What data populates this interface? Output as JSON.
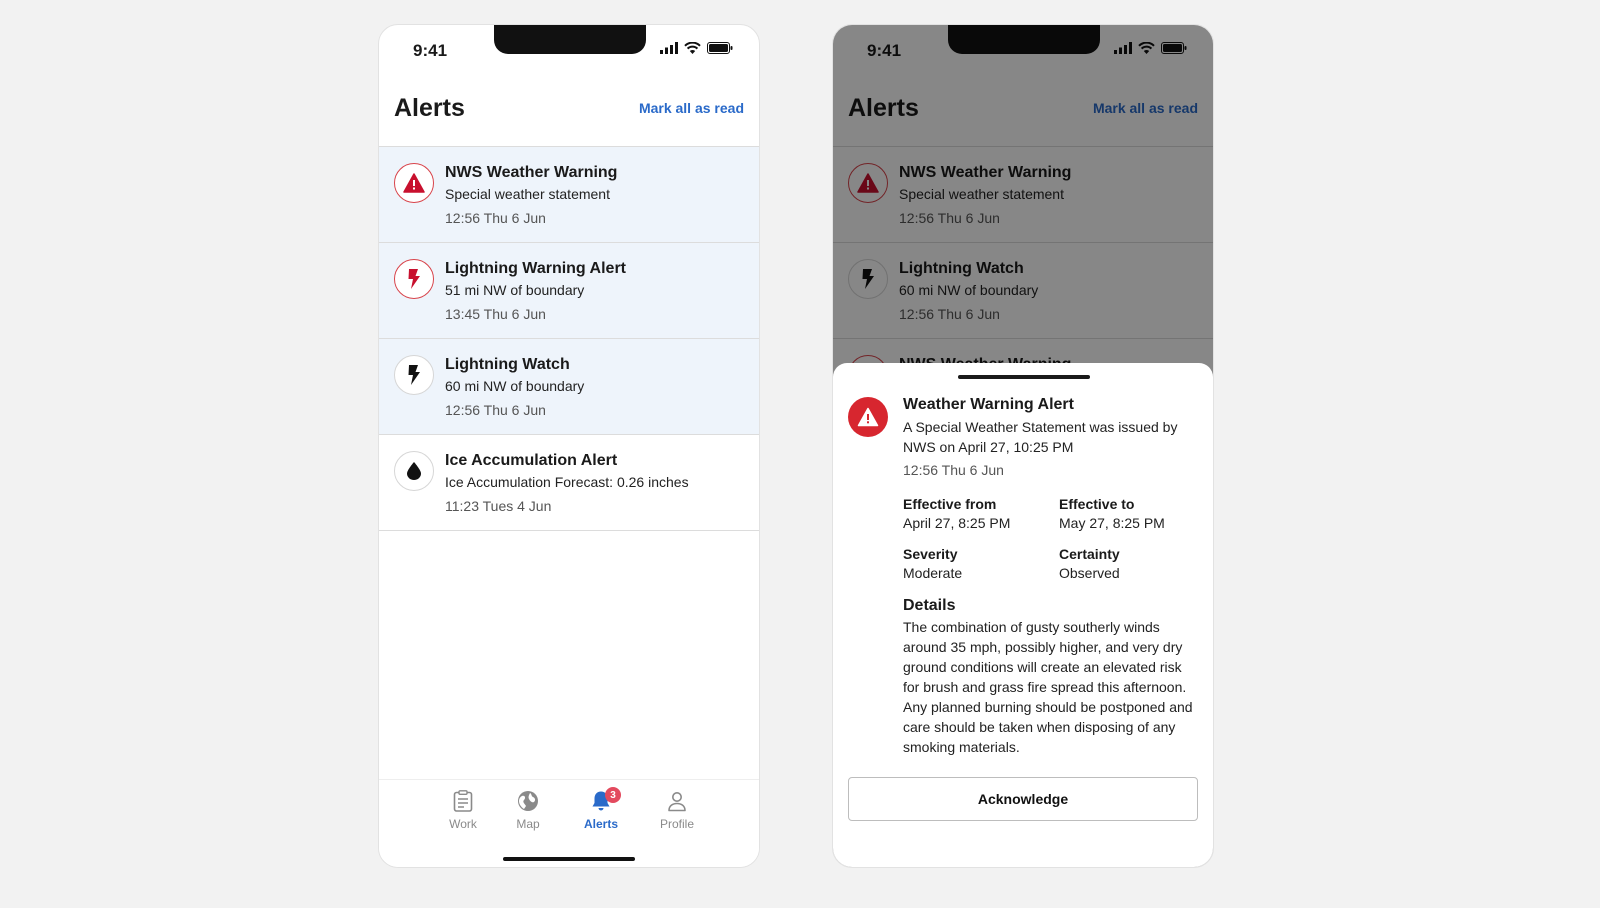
{
  "status_bar": {
    "time": "9:41"
  },
  "header": {
    "title": "Alerts",
    "mark_all_label": "Mark all as read"
  },
  "alerts": [
    {
      "title": "NWS Weather Warning",
      "subtitle": "Special weather statement",
      "time": "12:56 Thu 6 Jun",
      "icon": "warning-triangle-icon",
      "unread": true
    },
    {
      "title": "Lightning Warning Alert",
      "subtitle": "51 mi NW of boundary",
      "time": "13:45 Thu 6 Jun",
      "icon": "lightning-icon",
      "unread": true
    },
    {
      "title": "Lightning Watch",
      "subtitle": "60 mi NW of boundary",
      "time": "12:56 Thu 6 Jun",
      "icon": "lightning-icon",
      "unread": true
    },
    {
      "title": "Ice Accumulation Alert",
      "subtitle": "Ice Accumulation Forecast: 0.26 inches",
      "time": "11:23 Tues 4 Jun",
      "icon": "droplet-icon",
      "unread": false
    }
  ],
  "background_list": [
    {
      "title": "NWS Weather Warning",
      "subtitle": "Special weather statement",
      "time": "12:56 Thu 6 Jun"
    },
    {
      "title": "Lightning Watch",
      "subtitle": "60 mi NW of boundary",
      "time": "12:56 Thu 6 Jun"
    },
    {
      "title": "NWS Weather Warning"
    }
  ],
  "tabs": [
    {
      "label": "Work",
      "icon": "clipboard-icon"
    },
    {
      "label": "Map",
      "icon": "globe-icon"
    },
    {
      "label": "Alerts",
      "icon": "bell-icon",
      "active": true,
      "badge": "3"
    },
    {
      "label": "Profile",
      "icon": "person-icon"
    }
  ],
  "detail_sheet": {
    "title": "Weather Warning Alert",
    "description": "A Special Weather Statement was issued by NWS on April 27, 10:25 PM",
    "time": "12:56 Thu 6 Jun",
    "effective_from_label": "Effective from",
    "effective_from": "April 27, 8:25 PM",
    "effective_to_label": "Effective to",
    "effective_to": "May 27, 8:25 PM",
    "severity_label": "Severity",
    "severity": "Moderate",
    "certainty_label": "Certainty",
    "certainty": "Observed",
    "details_heading": "Details",
    "details_body": "The combination of gusty southerly winds around 35 mph, possibly higher, and very dry ground conditions will create an elevated risk for brush and grass fire spread this afternoon. Any planned burning should be postponed and care should be taken when disposing of any smoking materials.",
    "acknowledge_label": "Acknowledge"
  },
  "colors": {
    "accent": "#2a6ac9",
    "danger": "#d7262f",
    "unread_bg": "#eef4fb",
    "badge": "#e34a5e"
  }
}
